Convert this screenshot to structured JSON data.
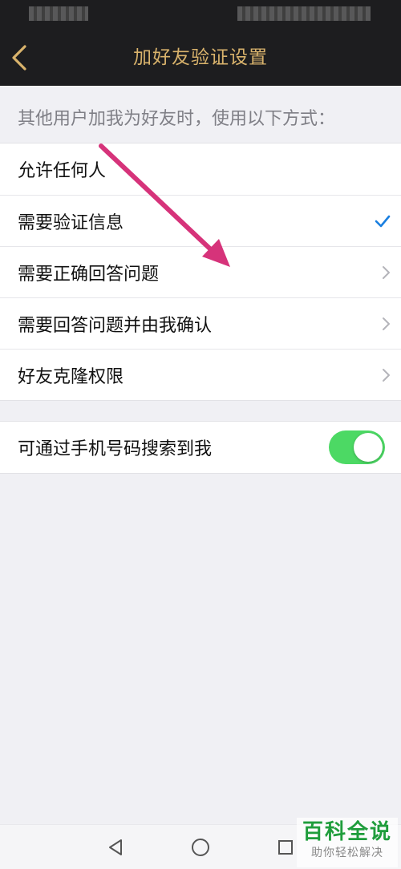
{
  "header": {
    "title": "加好友验证设置",
    "back_icon": "chevron-left-icon",
    "title_color": "#d9b36c",
    "background": "#1d1d1f"
  },
  "hint": "其他用户加我为好友时，使用以下方式：",
  "verification_options": [
    {
      "label": "允许任何人",
      "trailing": "none"
    },
    {
      "label": "需要验证信息",
      "trailing": "checkmark-icon",
      "selected": true
    },
    {
      "label": "需要正确回答问题",
      "trailing": "chevron-right-icon"
    },
    {
      "label": "需要回答问题并由我确认",
      "trailing": "chevron-right-icon"
    },
    {
      "label": "好友克隆权限",
      "trailing": "chevron-right-icon"
    }
  ],
  "phone_search": {
    "label": "可通过手机号码搜索到我",
    "enabled": true,
    "toggle_color": "#4cd964"
  },
  "annotation": {
    "type": "arrow",
    "color": "#d6337a"
  },
  "nav_bar": {
    "buttons": [
      "back-triangle-icon",
      "home-circle-icon",
      "recents-square-icon"
    ]
  },
  "watermark": {
    "main": "百科全说",
    "sub": "助你轻松解决"
  },
  "colors": {
    "accent_check": "#1a7fe0",
    "background": "#f0f0f4"
  }
}
